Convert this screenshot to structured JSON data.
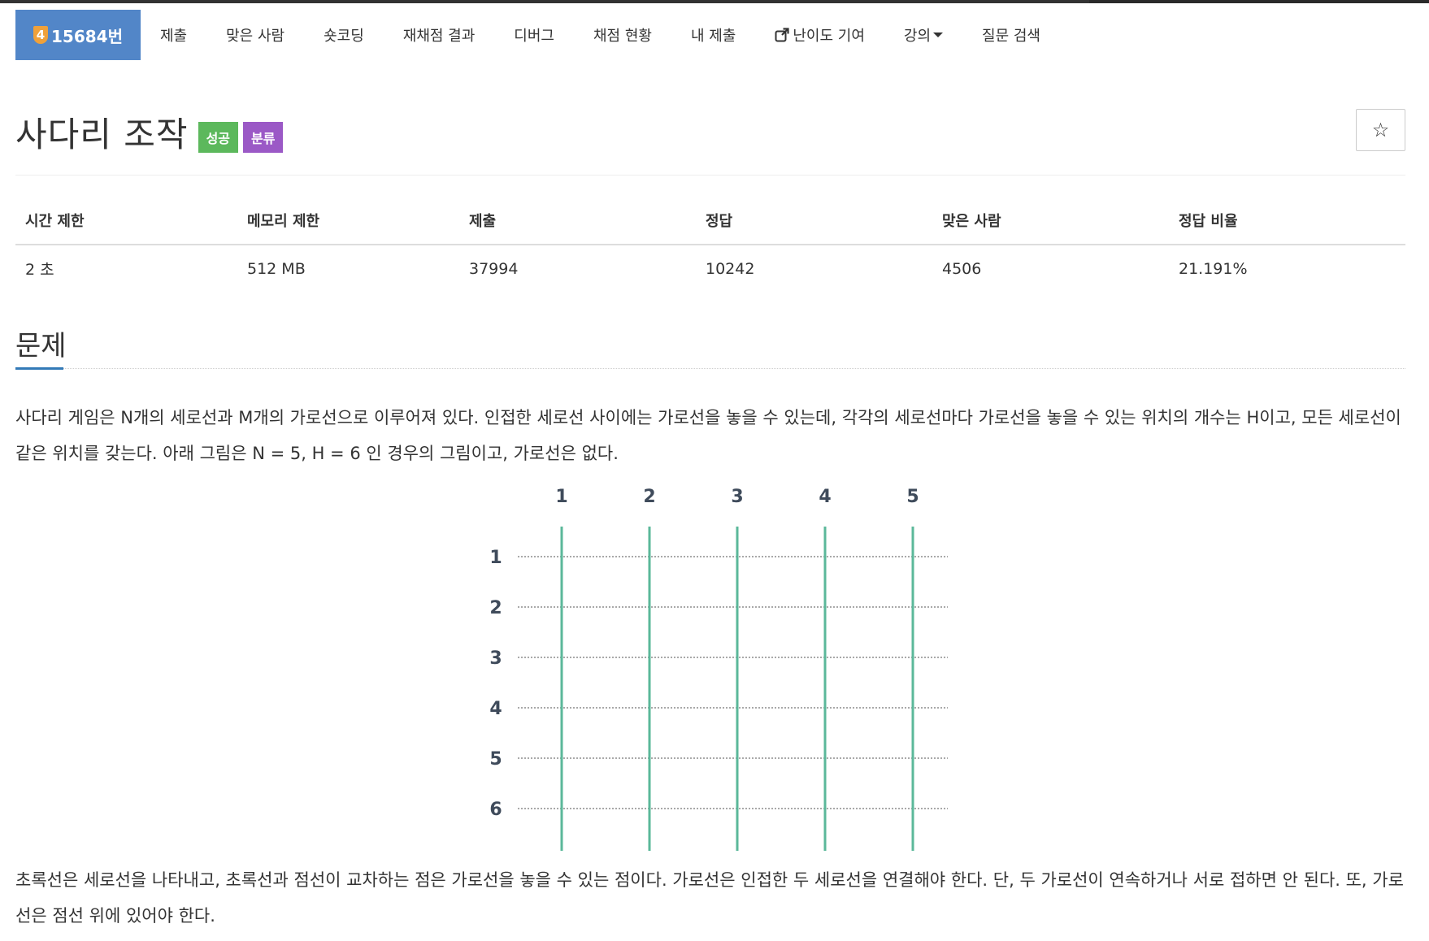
{
  "nav": {
    "problem_badge": "4",
    "problem_label": "15684번",
    "items": [
      "제출",
      "맞은 사람",
      "숏코딩",
      "재채점 결과",
      "디버그",
      "채점 현황",
      "내 제출"
    ],
    "difficulty_label": "난이도 기여",
    "lecture_label": "강의",
    "question_label": "질문 검색"
  },
  "problem": {
    "title": "사다리 조작",
    "badge_success": "성공",
    "badge_category": "분류",
    "star": "☆"
  },
  "info": {
    "headers": [
      "시간 제한",
      "메모리 제한",
      "제출",
      "정답",
      "맞은 사람",
      "정답 비율"
    ],
    "values": [
      "2 초",
      "512 MB",
      "37994",
      "10242",
      "4506",
      "21.191%"
    ]
  },
  "section": {
    "title": "문제",
    "para1": "사다리 게임은 N개의 세로선과 M개의 가로선으로 이루어져 있다. 인접한 세로선 사이에는 가로선을 놓을 수 있는데, 각각의 세로선마다 가로선을 놓을 수 있는 위치의 개수는 H이고, 모든 세로선이 같은 위치를 갖는다. 아래 그림은 N = 5, H = 6 인 경우의 그림이고, 가로선은 없다.",
    "para2": "초록선은 세로선을 나타내고, 초록선과 점선이 교차하는 점은 가로선을 놓을 수 있는 점이다. 가로선은 인접한 두 세로선을 연결해야 한다. 단, 두 가로선이 연속하거나 서로 접하면 안 된다. 또, 가로선은 점선 위에 있어야 한다."
  },
  "figure": {
    "column_labels": [
      "1",
      "2",
      "3",
      "4",
      "5"
    ],
    "row_labels": [
      "1",
      "2",
      "3",
      "4",
      "5",
      "6"
    ],
    "colors": {
      "vertical": "#5bb89a",
      "dotted": "#a9a9a9",
      "label": "#3f4b5b"
    }
  },
  "colors": {
    "nav_active": "#5286c8",
    "success": "#5cb85c",
    "category": "#9b59c6",
    "accent": "#337ab7"
  }
}
